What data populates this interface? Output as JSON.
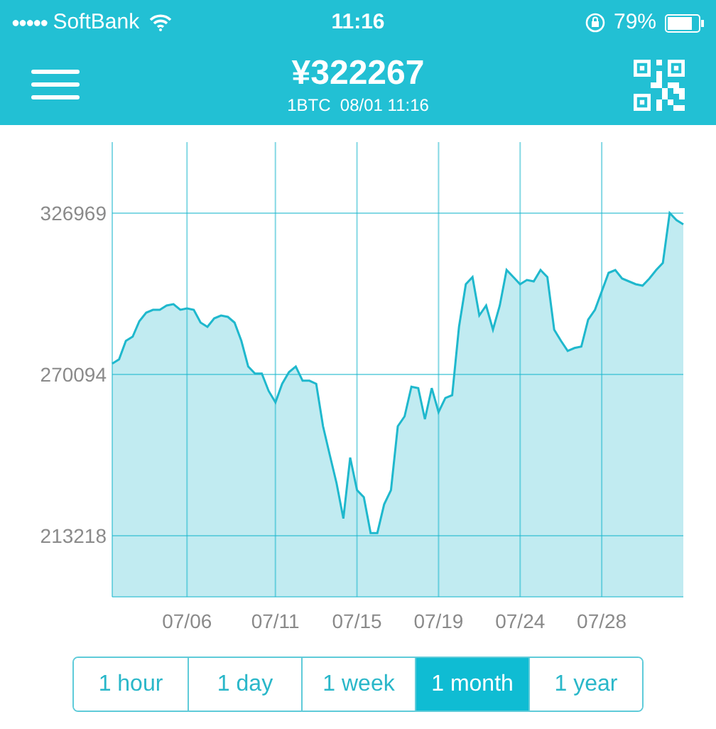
{
  "status_bar": {
    "signal": "●●●●●",
    "carrier": "SoftBank",
    "time": "11:16",
    "battery": "79%"
  },
  "header": {
    "price": "¥322267",
    "subtitle": "1BTC  08/01 11:16"
  },
  "chart": {
    "chart_data": {
      "type": "area",
      "grid": true,
      "ylim": [
        191700,
        352000
      ],
      "yticks": [
        213218,
        270094,
        326969
      ],
      "categories": [
        null,
        null,
        null,
        null,
        null,
        null,
        null,
        null,
        null,
        null,
        null,
        "07/06",
        null,
        null,
        null,
        null,
        null,
        null,
        null,
        null,
        null,
        null,
        null,
        null,
        "07/11",
        null,
        null,
        null,
        null,
        null,
        null,
        null,
        null,
        null,
        null,
        null,
        "07/15",
        null,
        null,
        null,
        null,
        null,
        null,
        null,
        null,
        null,
        null,
        null,
        "07/19",
        null,
        null,
        null,
        null,
        null,
        null,
        null,
        null,
        null,
        null,
        null,
        "07/24",
        null,
        null,
        null,
        null,
        null,
        null,
        null,
        null,
        null,
        null,
        null,
        "07/28",
        null,
        null,
        null,
        null,
        null,
        null,
        null,
        null,
        null,
        null,
        null,
        null
      ],
      "series": [
        {
          "color": "#1fb8cd",
          "values": [
            273900,
            275400,
            281900,
            283400,
            288900,
            291900,
            292900,
            292900,
            294400,
            294900,
            292900,
            293400,
            292900,
            288400,
            286900,
            289900,
            290900,
            290400,
            288400,
            281900,
            272900,
            270400,
            270400,
            264300,
            260300,
            266800,
            270900,
            272900,
            267900,
            267900,
            266800,
            251800,
            241800,
            231800,
            219300,
            240800,
            229300,
            226800,
            214200,
            214200,
            224300,
            229300,
            251800,
            255300,
            265800,
            265300,
            254300,
            265300,
            256800,
            261800,
            262800,
            286900,
            301900,
            304400,
            290900,
            294400,
            285900,
            294400,
            306900,
            304400,
            301900,
            303400,
            302900,
            306900,
            304400,
            285900,
            281900,
            278400,
            279400,
            279900,
            289400,
            292900,
            299400,
            305900,
            306900,
            303900,
            302900,
            301900,
            301400,
            303900,
            306900,
            309400,
            327000,
            324500,
            323000
          ]
        }
      ]
    }
  },
  "ranges": [
    {
      "label": "1 hour",
      "selected": false
    },
    {
      "label": "1 day",
      "selected": false
    },
    {
      "label": "1 week",
      "selected": false
    },
    {
      "label": "1 month",
      "selected": true
    },
    {
      "label": "1 year",
      "selected": false
    }
  ]
}
